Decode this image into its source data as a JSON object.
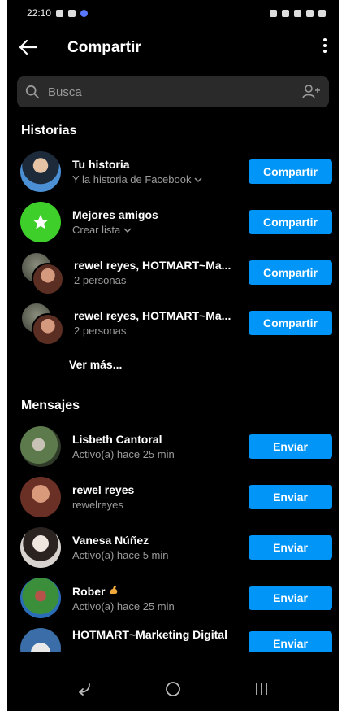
{
  "status_bar": {
    "time": "22:10"
  },
  "app_bar": {
    "title": "Compartir"
  },
  "search": {
    "placeholder": "Busca"
  },
  "stories_section": {
    "title": "Historias",
    "items": [
      {
        "title": "Tu historia",
        "subtitle": "Y la historia de Facebook",
        "button": "Compartir"
      },
      {
        "title": "Mejores amigos",
        "subtitle": "Crear lista",
        "button": "Compartir"
      },
      {
        "title": "rewel reyes, HOTMART~Ma...",
        "subtitle": "2 personas",
        "button": "Compartir"
      },
      {
        "title": "rewel reyes, HOTMART~Ma...",
        "subtitle": "2 personas",
        "button": "Compartir"
      }
    ],
    "see_more": "Ver más..."
  },
  "messages_section": {
    "title": "Mensajes",
    "items": [
      {
        "title": "Lisbeth Cantoral",
        "subtitle": "Activo(a) hace 25 min",
        "button": "Enviar"
      },
      {
        "title": "rewel reyes",
        "subtitle": "rewelreyes",
        "button": "Enviar"
      },
      {
        "title": "Vanesa Núñez",
        "subtitle": "Activo(a) hace 5 min",
        "button": "Enviar"
      },
      {
        "title": "Rober",
        "subtitle": "Activo(a) hace 25 min",
        "button": "Enviar"
      },
      {
        "title": "HOTMART~Marketing Digital",
        "subtitle": "",
        "button": "Enviar"
      }
    ]
  },
  "colors": {
    "accent": "#0095f6",
    "background": "#000000",
    "secondary_text": "#9b9b9b",
    "star_badge": "#3ecf2a"
  },
  "icons": [
    "back-arrow-icon",
    "more-vertical-icon",
    "search-icon",
    "add-people-icon",
    "star-icon",
    "chevron-down-icon",
    "nav-back-icon",
    "nav-home-icon",
    "nav-recents-icon"
  ]
}
